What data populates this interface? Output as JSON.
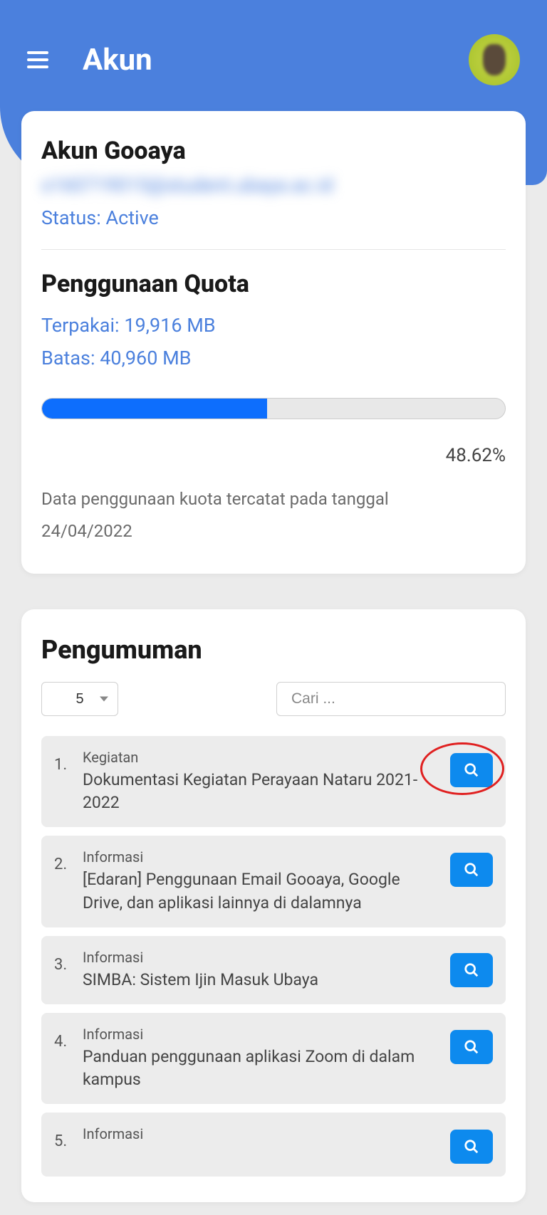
{
  "header": {
    "title": "Akun"
  },
  "account": {
    "title": "Akun Gooaya",
    "email_blurred": "s160719015@student.ubaya.ac.id",
    "status_label": "Status:",
    "status_value": "Active"
  },
  "quota": {
    "title": "Penggunaan Quota",
    "used_label": "Terpakai:",
    "used_value": "19,916 MB",
    "limit_label": "Batas:",
    "limit_value": "40,960 MB",
    "percent": "48.62%",
    "progress_width": "48.62%",
    "note_prefix": "Data penggunaan kuota tercatat pada tanggal",
    "note_date": "24/04/2022"
  },
  "announcements": {
    "title": "Pengumuman",
    "page_size": "5",
    "search_placeholder": "Cari ...",
    "items": [
      {
        "num": "1.",
        "category": "Kegiatan",
        "title": "Dokumentasi Kegiatan Perayaan Nataru 2021-2022",
        "highlighted": true
      },
      {
        "num": "2.",
        "category": "Informasi",
        "title": "[Edaran] Penggunaan Email Gooaya, Google Drive, dan aplikasi lainnya di dalamnya"
      },
      {
        "num": "3.",
        "category": "Informasi",
        "title": "SIMBA: Sistem Ijin Masuk Ubaya"
      },
      {
        "num": "4.",
        "category": "Informasi",
        "title": "Panduan penggunaan aplikasi Zoom di dalam kampus"
      },
      {
        "num": "5.",
        "category": "Informasi",
        "title": ""
      }
    ]
  },
  "colors": {
    "primary": "#4b80dd",
    "accent": "#0d8aee",
    "progress": "#0d6efd"
  }
}
